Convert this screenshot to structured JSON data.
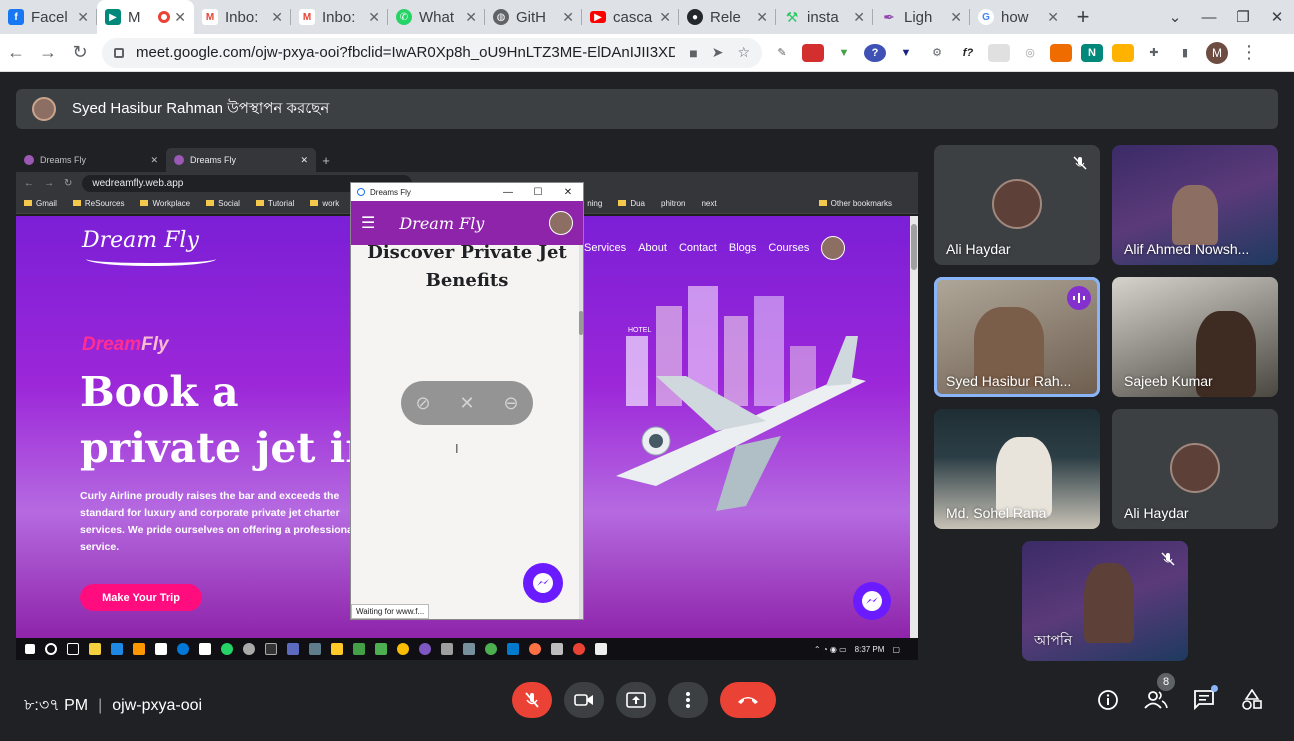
{
  "browser": {
    "tabs": [
      {
        "label": "Facel",
        "icon": "facebook-icon",
        "color": "#1877f2"
      },
      {
        "label": "M",
        "icon": "meet-icon",
        "color": "#00897b",
        "active": true
      },
      {
        "label": "Inbo:",
        "icon": "gmail-icon",
        "color": "#ea4335"
      },
      {
        "label": "Inbo:",
        "icon": "gmail-icon",
        "color": "#ea4335"
      },
      {
        "label": "What",
        "icon": "whatsapp-icon",
        "color": "#25d366"
      },
      {
        "label": "GitH",
        "icon": "globe-icon",
        "color": "#5f6368"
      },
      {
        "label": "casca",
        "icon": "youtube-icon",
        "color": "#ff0000"
      },
      {
        "label": "Rele",
        "icon": "github-icon",
        "color": "#24292e"
      },
      {
        "label": "insta",
        "icon": "hackerrank-icon",
        "color": "#2ec866"
      },
      {
        "label": "Ligh",
        "icon": "feather-icon",
        "color": "#8e44ad"
      },
      {
        "label": "how",
        "icon": "google-icon",
        "color": "#4285f4"
      }
    ],
    "url": "meet.google.com/ojw-pxya-ooi?fbclid=IwAR0Xp8h_oU9HnLTZ3ME-ElDAnIJII3XD...",
    "profile_initial": "M"
  },
  "presenter_bar": {
    "text": "Syed Hasibur Rahman উপস্থাপন করছেন"
  },
  "shared_screen": {
    "inner_tabs": [
      "Dreams Fly",
      "Dreams Fly"
    ],
    "inner_url": "wedreamfly.web.app",
    "bookmarks": [
      "Gmail",
      "ReSources",
      "Workplace",
      "Social",
      "Tutorial",
      "work",
      "ning",
      "Dua",
      "phitron",
      "next",
      "Other bookmarks"
    ],
    "site": {
      "logo": "Dream Fly",
      "nav": [
        "Services",
        "About",
        "Contact",
        "Blogs",
        "Courses"
      ],
      "brand_a": "Dream",
      "brand_b": "Fly",
      "headline": "Book a private jet in|",
      "lead": "Curly Airline proudly raises the bar and exceeds the standard for luxury and corporate private jet charter services. We pride ourselves on offering a professional service.",
      "cta": "Make Your Trip",
      "hotel_sign": "HOTEL"
    },
    "popup": {
      "title": "Dreams Fly",
      "logo": "Dream Fly",
      "heading": "Discover Private Jet Benefits",
      "status": "Waiting for www.f..."
    },
    "taskbar_clock": "8:37 PM"
  },
  "participants": [
    {
      "name": "Ali Haydar",
      "muted": true,
      "has_video": false
    },
    {
      "name": "Alif Ahmed Nowsh...",
      "muted": false,
      "has_video": true
    },
    {
      "name": "Syed Hasibur Rah...",
      "muted": false,
      "has_video": true,
      "speaking": true
    },
    {
      "name": "Sajeeb Kumar",
      "muted": false,
      "has_video": true
    },
    {
      "name": "Md. Sohel Rana",
      "muted": false,
      "has_video": true
    },
    {
      "name": "Ali Haydar",
      "muted": false,
      "has_video": false
    },
    {
      "name": "আপনি",
      "muted": true,
      "has_video": true
    }
  ],
  "meeting": {
    "time": "৮:৩৭ PM",
    "code": "ojw-pxya-ooi",
    "participant_count": "8"
  },
  "colors": {
    "end_call": "#ea4335",
    "mic_off": "#ea4335",
    "speaking_outline": "#8ab4f8",
    "site_purple": "#8e24aa",
    "cta_pink": "#ff0d7e"
  }
}
